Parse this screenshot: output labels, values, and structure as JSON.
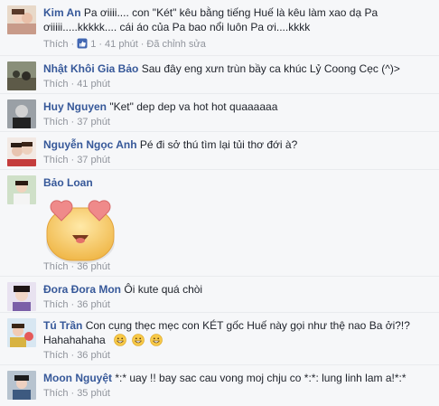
{
  "comments": [
    {
      "author": "Kim An",
      "text": "Pa ơiiii.... con \"Két\" kêu bằng tiếng Huế là kêu làm xao dạ Pa ơiiiii.....kkkkk.... cái áo của Pa bao nổi luôn Pa ơi....kkkk",
      "like": "Thích",
      "like_count": "1",
      "time": "41 phút",
      "edited": "Đã chỉnh sửa"
    },
    {
      "author": "Nhật Khôi Gia Bảo",
      "text": "Sau đây eng xưn trùn bầy ca khúc Lỷ Coong Cẹc (^)>",
      "like": "Thích",
      "time": "41 phút"
    },
    {
      "author": "Huy Nguyen",
      "text": "\"Ket\" dep dep va hot hot quaaaaaa",
      "like": "Thích",
      "time": "37 phút"
    },
    {
      "author": "Nguyễn Ngọc Anh",
      "text": "Pé đi sở thú tìm lại tủi thơ đới à?",
      "like": "Thích",
      "time": "37 phút"
    },
    {
      "author": "Bảo Loan",
      "text": "",
      "sticker": "heart-eyes-sticker",
      "like": "Thích",
      "time": "36 phút"
    },
    {
      "author": "Đora Đora Mon",
      "text": "Ôi kute quá chòi",
      "like": "Thích",
      "time": "36 phút"
    },
    {
      "author": "Tú Trần",
      "text": "Con cụng thẹc mẹc con KÉT gốc Huế này gọi như thệ nao Ba ởi?!? Hahahahaha",
      "emojis": [
        "grin-emoji",
        "grin-emoji",
        "grin-emoji"
      ],
      "like": "Thích",
      "time": "36 phút"
    },
    {
      "author": "Moon Nguyệt",
      "text": "*:* uay !! bay sac cau vong moj chju co *:*: lung linh lam a!*:*",
      "like": "Thích",
      "time": "35 phút"
    }
  ],
  "colors": {
    "author": "#365899",
    "meta": "#90949c",
    "like_icon": "#4267b2",
    "background": "#f6f7f9"
  }
}
